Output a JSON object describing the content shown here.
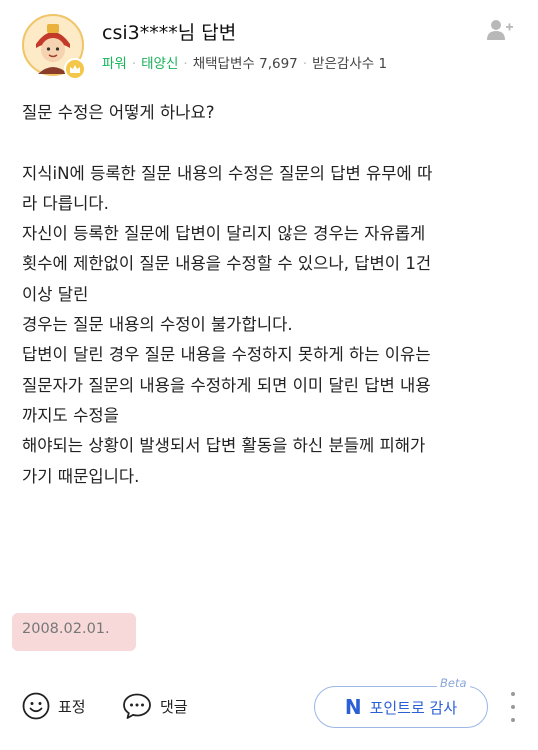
{
  "header": {
    "username": "csi3****",
    "username_suffix": "님 답변",
    "rank": "파워",
    "level": "태양신",
    "adopted_label": "채택답변수",
    "adopted_count": "7,697",
    "thanks_label": "받은감사수",
    "thanks_count": "1"
  },
  "content": {
    "lines": [
      "질문 수정은 어떻게 하나요?",
      "",
      "지식iN에 등록한 질문 내용의 수정은 질문의 답변 유무에 따",
      "라 다릅니다.",
      "자신이 등록한 질문에 답변이 달리지 않은 경우는 자유롭게",
      "횟수에 제한없이 질문 내용을 수정할 수 있으나, 답변이 1건",
      "이상 달린",
      "경우는 질문 내용의 수정이 불가합니다.",
      "답변이 달린 경우 질문 내용을 수정하지 못하게 하는 이유는",
      "질문자가 질문의 내용을 수정하게 되면 이미 달린 답변 내용",
      "까지도 수정을",
      "해야되는 상황이 발생되서 답변 활동을 하신 분들께 피해가",
      "가기 때문입니다."
    ]
  },
  "date": "2008.02.01.",
  "footer": {
    "reaction_label": "표정",
    "comment_label": "댓글",
    "point_label": "포인트로 감사",
    "point_logo": "N",
    "beta_label": "Beta"
  },
  "colors": {
    "accent_blue": "#2b5fd6",
    "rank_green": "#19b45a",
    "date_highlight": "#f8d9d9"
  },
  "icons": [
    "avatar",
    "crown-badge-icon",
    "follow-user-icon",
    "smile-icon",
    "speech-bubble-icon",
    "more-vertical-icon"
  ]
}
